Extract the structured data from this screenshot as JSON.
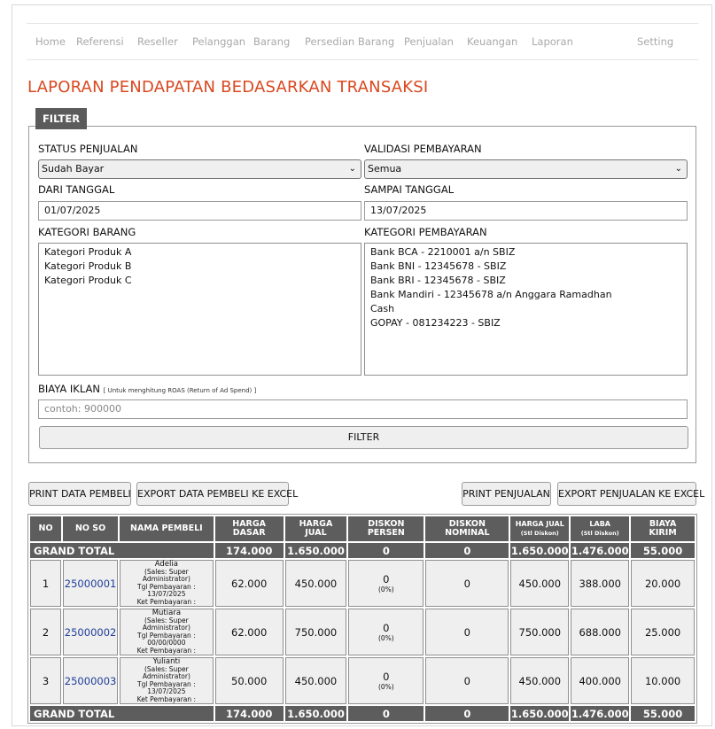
{
  "nav": {
    "items": [
      "Home",
      "Referensi",
      "Reseller",
      "Pelanggan",
      "Barang",
      "Persedian Barang",
      "Penjualan",
      "Keuangan",
      "Laporan"
    ],
    "setting": "Setting"
  },
  "page_title": "LAPORAN PENDAPATAN BEDASARKAN TRANSAKSI",
  "filter": {
    "tab_label": "FILTER",
    "status_label": "STATUS PENJUALAN",
    "status_value": "Sudah Bayar",
    "validasi_label": "VALIDASI PEMBAYARAN",
    "validasi_value": "Semua",
    "dari_label": "DARI TANGGAL",
    "dari_value": "01/07/2025",
    "sampai_label": "SAMPAI TANGGAL",
    "sampai_value": "13/07/2025",
    "kategori_barang_label": "KATEGORI BARANG",
    "kategori_barang": [
      "Kategori Produk A",
      "Kategori Produk B",
      "Kategori Produk C"
    ],
    "kategori_pembayaran_label": "KATEGORI PEMBAYARAN",
    "kategori_pembayaran": [
      "Bank BCA - 2210001 a/n SBIZ",
      "Bank BNI - 12345678 - SBIZ",
      "Bank BRI - 12345678 - SBIZ",
      "Bank Mandiri - 12345678 a/n Anggara Ramadhan",
      "Cash",
      "GOPAY - 081234223 - SBIZ"
    ],
    "biaya_label": "BIAYA IKLAN",
    "biaya_note": "[ Untuk menghitung ROAS (Return of Ad Spend) ]",
    "biaya_placeholder": "contoh: 900000",
    "submit_label": "FILTER"
  },
  "actions": {
    "print_pembeli": "PRINT DATA PEMBELI",
    "export_pembeli": "EXPORT DATA PEMBELI KE EXCEL",
    "print_penjualan": "PRINT PENJUALAN",
    "export_penjualan": "EXPORT PENJUALAN KE EXCEL"
  },
  "table": {
    "headers": {
      "no": "NO",
      "no_so": "NO SO",
      "nama": "NAMA PEMBELI",
      "harga_dasar_1": "HARGA",
      "harga_dasar_2": "DASAR",
      "harga_jual_1": "HARGA",
      "harga_jual_2": "JUAL",
      "diskon_persen_1": "DISKON",
      "diskon_persen_2": "PERSEN",
      "diskon_nominal_1": "DISKON",
      "diskon_nominal_2": "NOMINAL",
      "harga_jual_sd_1": "HARGA JUAL",
      "harga_jual_sd_2": "(Stl Diskon)",
      "laba_1": "LABA",
      "laba_2": "(Stl Diskon)",
      "biaya_kirim_1": "BIAYA",
      "biaya_kirim_2": "KIRIM"
    },
    "grand_total": {
      "label": "GRAND TOTAL",
      "harga_dasar": "174.000",
      "harga_jual": "1.650.000",
      "diskon_persen": "0",
      "diskon_nominal": "0",
      "harga_jual_sd": "1.650.000",
      "laba": "1.476.000",
      "biaya_kirim": "55.000"
    },
    "rows": [
      {
        "no": "1",
        "no_so": "25000001",
        "nama": "Adelia",
        "sales": "(Sales: Super Administrator)",
        "tgl_label": "Tgl Pembayaran :",
        "tgl": "13/07/2025",
        "ket": "Ket Pembayaran :",
        "harga_dasar": "62.000",
        "harga_jual": "450.000",
        "diskon_persen": "0",
        "diskon_pct": "(0%)",
        "diskon_nominal": "0",
        "harga_jual_sd": "450.000",
        "laba": "388.000",
        "biaya_kirim": "20.000"
      },
      {
        "no": "2",
        "no_so": "25000002",
        "nama": "Mutiara",
        "sales": "(Sales: Super Administrator)",
        "tgl_label": "Tgl Pembayaran :",
        "tgl": "00/00/0000",
        "ket": "Ket Pembayaran :",
        "harga_dasar": "62.000",
        "harga_jual": "750.000",
        "diskon_persen": "0",
        "diskon_pct": "(0%)",
        "diskon_nominal": "0",
        "harga_jual_sd": "750.000",
        "laba": "688.000",
        "biaya_kirim": "25.000"
      },
      {
        "no": "3",
        "no_so": "25000003",
        "nama": "Yulianti",
        "sales": "(Sales: Super Administrator)",
        "tgl_label": "Tgl Pembayaran :",
        "tgl": "13/07/2025",
        "ket": "Ket Pembayaran :",
        "harga_dasar": "50.000",
        "harga_jual": "450.000",
        "diskon_persen": "0",
        "diskon_pct": "(0%)",
        "diskon_nominal": "0",
        "harga_jual_sd": "450.000",
        "laba": "400.000",
        "biaya_kirim": "10.000"
      }
    ]
  }
}
